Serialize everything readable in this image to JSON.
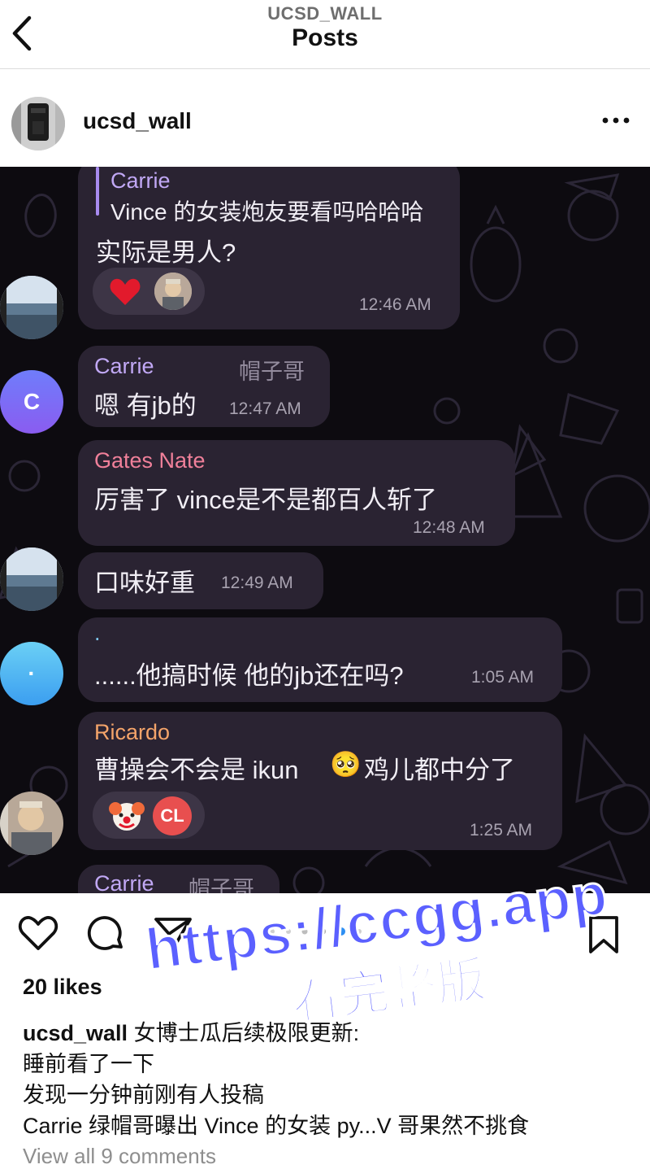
{
  "header": {
    "subtitle": "UCSD_WALL",
    "title": "Posts"
  },
  "post": {
    "username": "ucsd_wall"
  },
  "chat": {
    "msg1": {
      "reply_name": "Carrie",
      "reply_text": "Vince 的女装炮友要看吗哈哈哈",
      "text": "实际是男人?",
      "time": "12:46 AM"
    },
    "msg2": {
      "name": "Carrie",
      "tag": "帽子哥",
      "text": "嗯 有jb的",
      "time": "12:47 AM",
      "avatar_letter": "C"
    },
    "msg3": {
      "name": "Gates Nate",
      "text": "厉害了 vince是不是都百人斩了",
      "time": "12:48 AM"
    },
    "msg4": {
      "text": "口味好重",
      "time": "12:49 AM"
    },
    "msg5": {
      "name": ".",
      "text": "......他搞时候 他的jb还在吗?",
      "time": "1:05 AM",
      "avatar_letter": "·"
    },
    "msg6": {
      "name": "Ricardo",
      "text_a": "曹操会不会是 ikun",
      "emoji": "🥺",
      "text_b": "鸡儿都中分了",
      "time": "1:25 AM",
      "reaction_initials": "CL"
    },
    "msg7": {
      "name": "Carrie",
      "tag": "帽子哥"
    }
  },
  "colors": {
    "carrie_name": "#c1a8f5",
    "gates_name": "#f0809a",
    "dot_name": "#7ec8f0",
    "ricardo_name": "#f4a46a",
    "watermark": "#5b60ff"
  },
  "engagement": {
    "likes": "20 likes"
  },
  "caption": {
    "username": "ucsd_wall",
    "line1": "女博士瓜后续极限更新:",
    "line2": "睡前看了一下",
    "line3": "发现一分钟前刚有人投稿",
    "line4": "Carrie 绿帽哥曝出 Vince 的女装 py...V 哥果然不挑食"
  },
  "comments": {
    "view_all": "View all 9 comments"
  },
  "watermark": {
    "line1": "https://ccgg.app",
    "line2": "看完整版"
  },
  "icons": [
    "back-arrow-icon",
    "more-options-icon",
    "heart-icon",
    "comment-icon",
    "share-icon",
    "bookmark-icon"
  ]
}
